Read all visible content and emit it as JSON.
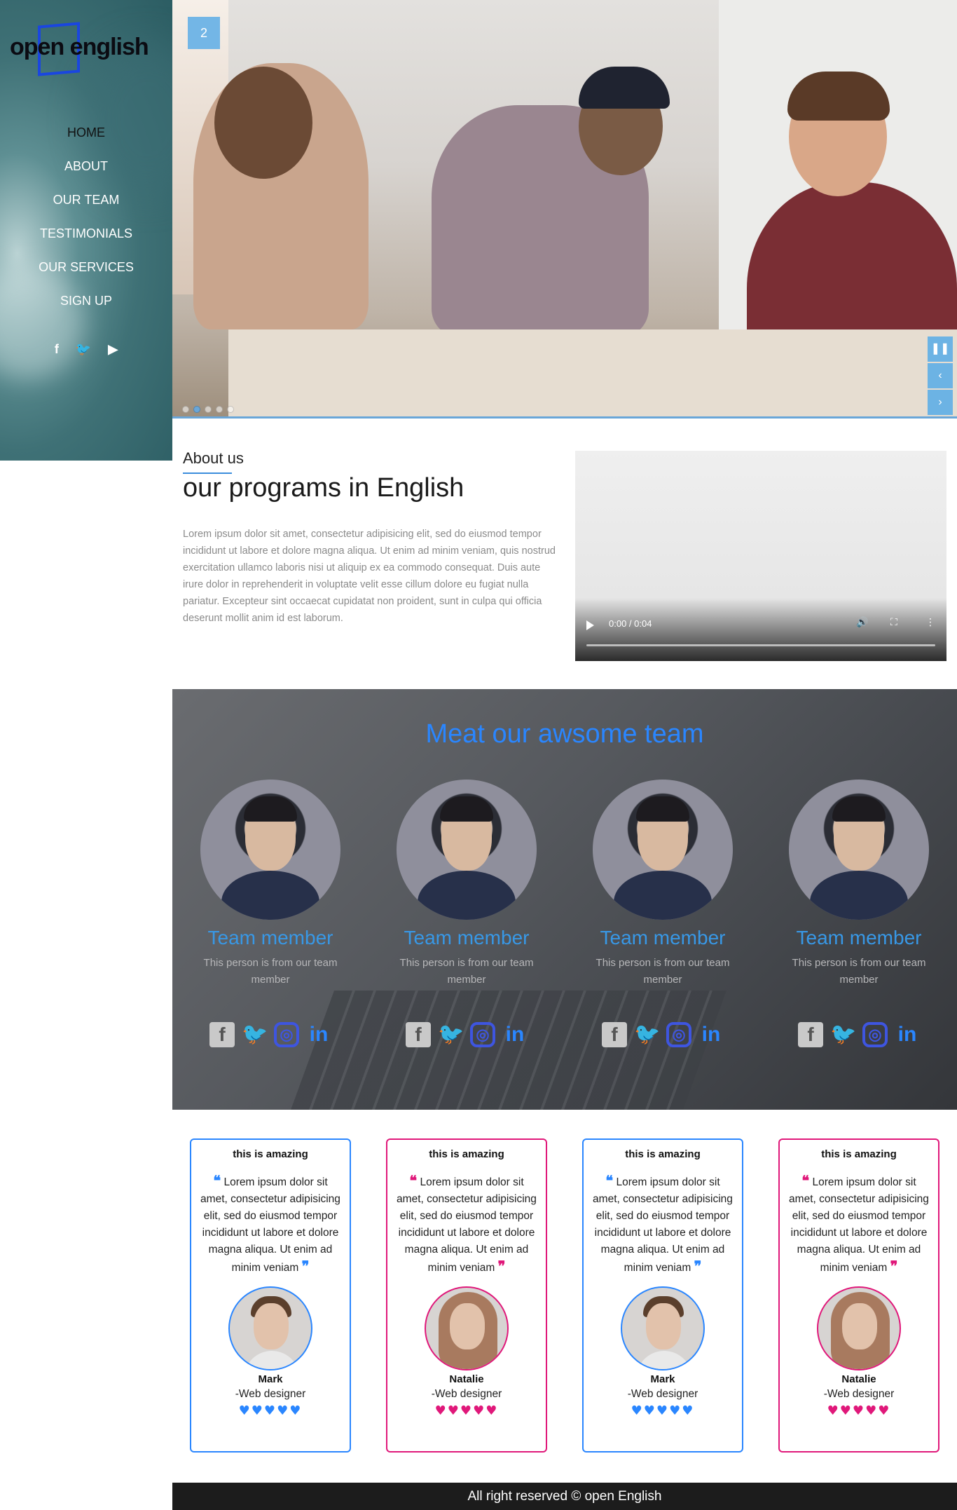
{
  "brand": {
    "logo_text": "open english"
  },
  "nav": {
    "items": [
      "HOME",
      "ABOUT",
      "OUR TEAM",
      "TESTIMONIALS",
      "OUR SERVICES",
      "SIGN UP"
    ]
  },
  "sidebar_social": [
    "facebook-icon",
    "twitter-icon",
    "youtube-icon"
  ],
  "hero": {
    "slide_number": "2",
    "controls": [
      "pause-icon",
      "prev-icon",
      "next-icon"
    ],
    "active_dot": 2,
    "dot_count": 5
  },
  "about": {
    "label": "About us",
    "title": "our programs in English",
    "text": "Lorem ipsum dolor sit amet, consectetur adipisicing elit, sed do eiusmod tempor incididunt ut labore et dolore magna aliqua. Ut enim ad minim veniam, quis nostrud exercitation ullamco laboris nisi ut aliquip ex ea commodo consequat. Duis aute irure dolor in reprehenderit in voluptate velit esse cillum dolore eu fugiat nulla pariatur. Excepteur sint occaecat cupidatat non proident, sunt in culpa qui officia deserunt mollit anim id est laborum.",
    "video_time": "0:00 / 0:04"
  },
  "team": {
    "title": "Meat our awsome team",
    "members": [
      {
        "name": "Team member",
        "desc": "This person is from our team member"
      },
      {
        "name": "Team member",
        "desc": "This person is from our team member"
      },
      {
        "name": "Team member",
        "desc": "This person is from our team member"
      },
      {
        "name": "Team member",
        "desc": "This person is from our team member"
      }
    ],
    "social_glyphs": {
      "fb": "f",
      "tw": "🐦",
      "ig": "◎",
      "in": "in"
    }
  },
  "testimonials": [
    {
      "title": "this is amazing",
      "quote": "Lorem ipsum dolor sit amet, consectetur adipisicing elit, sed do eiusmod tempor incididunt ut labore et dolore magna aliqua. Ut enim ad minim veniam",
      "name": "Mark",
      "role": "-Web designer",
      "accent": "#2a86ff",
      "rating": 5
    },
    {
      "title": "this is amazing",
      "quote": "Lorem ipsum dolor sit amet, consectetur adipisicing elit, sed do eiusmod tempor incididunt ut labore et dolore magna aliqua. Ut enim ad minim veniam",
      "name": "Natalie",
      "role": "-Web designer",
      "accent": "#e0187a",
      "rating": 5
    },
    {
      "title": "this is amazing",
      "quote": "Lorem ipsum dolor sit amet, consectetur adipisicing elit, sed do eiusmod tempor incididunt ut labore et dolore magna aliqua. Ut enim ad minim veniam",
      "name": "Mark",
      "role": "-Web designer",
      "accent": "#2a86ff",
      "rating": 5
    },
    {
      "title": "this is amazing",
      "quote": "Lorem ipsum dolor sit amet, consectetur adipisicing elit, sed do eiusmod tempor incididunt ut labore et dolore magna aliqua. Ut enim ad minim veniam",
      "name": "Natalie",
      "role": "-Web designer",
      "accent": "#e0187a",
      "rating": 5
    }
  ],
  "footer": {
    "text": "All right reserved © open English"
  }
}
